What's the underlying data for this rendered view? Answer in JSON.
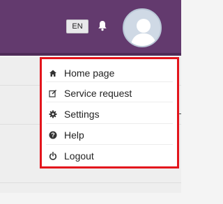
{
  "header": {
    "language": "EN",
    "icons": {
      "bell": "bell-icon",
      "avatar": "user-avatar-icon"
    },
    "colors": {
      "bar": "#633a6e"
    }
  },
  "menu": {
    "items": [
      {
        "label": "Home page",
        "icon": "home-icon"
      },
      {
        "label": "Service request",
        "icon": "edit-icon"
      },
      {
        "label": "Settings",
        "icon": "gear-icon"
      },
      {
        "label": "Help",
        "icon": "question-circle-icon"
      },
      {
        "label": "Logout",
        "icon": "power-icon"
      }
    ],
    "highlight_color": "#e3141c"
  }
}
